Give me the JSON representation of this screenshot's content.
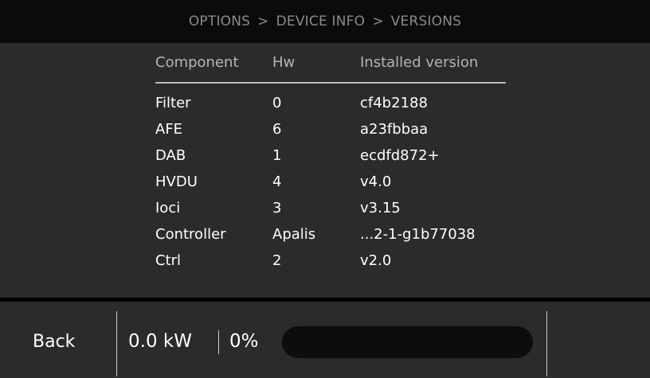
{
  "breadcrumb": {
    "items": [
      "OPTIONS",
      "DEVICE INFO",
      "VERSIONS"
    ],
    "separator": ">"
  },
  "table": {
    "headers": {
      "component": "Component",
      "hw": "Hw",
      "version": "Installed version"
    },
    "rows": [
      {
        "component": "Filter",
        "hw": "0",
        "version": "cf4b2188"
      },
      {
        "component": "AFE",
        "hw": "6",
        "version": "a23fbbaa"
      },
      {
        "component": "DAB",
        "hw": "1",
        "version": "ecdfd872+"
      },
      {
        "component": "HVDU",
        "hw": "4",
        "version": "v4.0"
      },
      {
        "component": "Ioci",
        "hw": "3",
        "version": "v3.15"
      },
      {
        "component": "Controller",
        "hw": "Apalis",
        "version": "...2-1-g1b77038"
      },
      {
        "component": "Ctrl",
        "hw": "2",
        "version": "v2.0"
      }
    ]
  },
  "footer": {
    "back_label": "Back",
    "power": "0.0 kW",
    "percent": "0%",
    "progress": 0,
    "progress_color": "#3a7bd5"
  },
  "colors": {
    "background": "#2b2b2b",
    "header": "#0b0b0b",
    "muted_text": "#8a8a8a"
  }
}
